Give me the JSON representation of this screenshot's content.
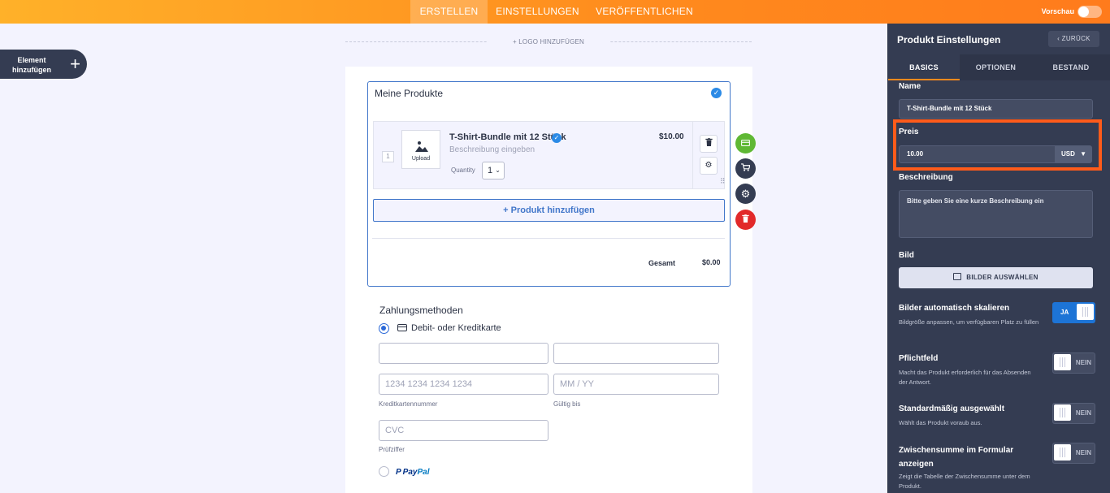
{
  "topbar": {
    "tabs": [
      "ERSTELLEN",
      "EINSTELLUNGEN",
      "VERÖFFENTLICHEN"
    ],
    "active_tab": "ERSTELLEN",
    "preview_label": "Vorschau",
    "preview_on": false
  },
  "sidebar": {
    "add_element_label": "Element hinzufügen",
    "add_icon": "plus-icon"
  },
  "form": {
    "logo_label": "+ LOGO HINZUFÜGEN",
    "product_widget": {
      "title": "Meine Produkte",
      "item": {
        "index": "1",
        "upload_label": "Upload",
        "name": "T-Shirt-Bundle mit 12 Stück",
        "description_placeholder": "Beschreibung eingeben",
        "price": "$10.00",
        "quantity_label": "Quantity",
        "quantity_value": "1"
      },
      "add_product_label": "+ Produkt hinzufügen",
      "total_label": "Gesamt",
      "total_value": "$0.00"
    },
    "payment": {
      "title": "Zahlungsmethoden",
      "card_option": "Debit- oder Kreditkarte",
      "card_number_placeholder": "1234 1234 1234 1234",
      "card_number_label": "Kreditkartennummer",
      "expiry_placeholder": "MM / YY",
      "expiry_label": "Gültig bis",
      "cvc_placeholder": "CVC",
      "cvc_label": "Prüfziffer",
      "paypal_pay": "Pay",
      "paypal_pal": "Pal"
    }
  },
  "side_actions": {
    "colors": {
      "payment": "#5fb834",
      "cart": "#343c52",
      "settings": "#343c52",
      "delete": "#e2292a"
    }
  },
  "panel": {
    "title": "Produkt Einstellungen",
    "back_label": "ZURÜCK",
    "tabs": [
      "BASICS",
      "OPTIONEN",
      "BESTAND"
    ],
    "active_tab": "BASICS",
    "name_label": "Name",
    "name_value": "T-Shirt-Bundle mit 12 Stück",
    "price_label": "Preis",
    "price_value": "10.00",
    "currency": "USD",
    "description_label": "Beschreibung",
    "description_placeholder": "Bitte geben Sie eine kurze Beschreibung ein",
    "image_label": "Bild",
    "image_button": "BILDER AUSWÄHLEN",
    "settings": [
      {
        "label": "Bilder automatisch skalieren",
        "desc": "Bildgröße anpassen, um verfügbaren Platz zu füllen",
        "state": "JA",
        "on": true
      },
      {
        "label": "Pflichtfeld",
        "desc": "Macht das Produkt erforderlich für das Absenden der Antwort.",
        "state": "NEIN",
        "on": false
      },
      {
        "label": "Standardmäßig ausgewählt",
        "desc": "Wählt das Produkt voraub aus.",
        "state": "NEIN",
        "on": false
      },
      {
        "label": "Zwischensumme im Formular anzeigen",
        "desc": "Zeigt die Tabelle der Zwischensumme unter dem Produkt.",
        "state": "NEIN",
        "on": false
      }
    ],
    "highlight_color": "#ff5b1a"
  }
}
